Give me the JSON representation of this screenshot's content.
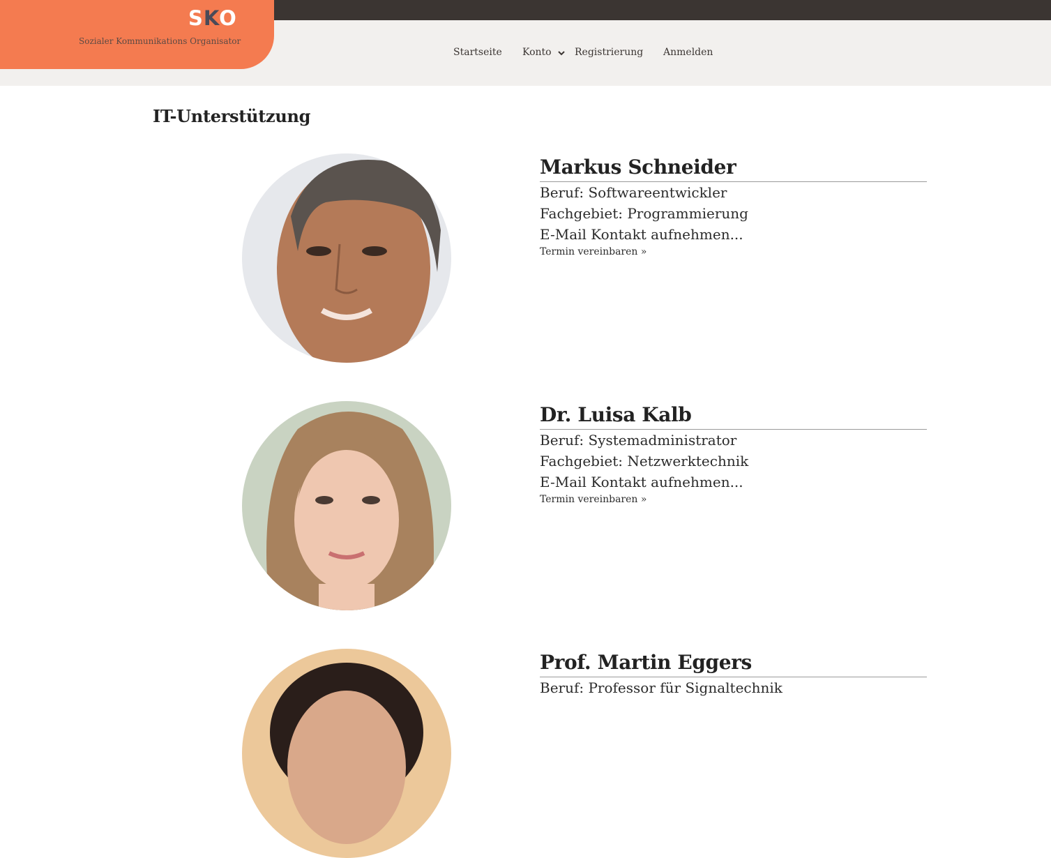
{
  "brand": {
    "logo_s": "S",
    "logo_k": "K",
    "logo_o": "O",
    "tagline": "Sozialer Kommunikations Organisator",
    "accent_color": "#f47b50",
    "dark_color": "#3b3532"
  },
  "nav": {
    "items": [
      {
        "label": "Startseite"
      },
      {
        "label": "Konto",
        "icon": "chevron-down-icon"
      },
      {
        "label": "Registrierung"
      },
      {
        "label": "Anmelden"
      }
    ]
  },
  "section": {
    "title": "IT-Unterstützung"
  },
  "people": [
    {
      "name": "Markus Schneider",
      "job": "Beruf: Softwareentwickler",
      "field": "Fachgebiet: Programmierung",
      "email": "E-Mail Kontakt aufnehmen...",
      "action": "Termin vereinbaren »"
    },
    {
      "name": "Dr. Luisa Kalb",
      "job": "Beruf: Systemadministrator",
      "field": "Fachgebiet: Netzwerktechnik",
      "email": "E-Mail Kontakt aufnehmen...",
      "action": "Termin vereinbaren »"
    },
    {
      "name": "Prof. Martin Eggers",
      "job": "Beruf: Professor für Signaltechnik",
      "field": "",
      "email": "",
      "action": ""
    }
  ]
}
